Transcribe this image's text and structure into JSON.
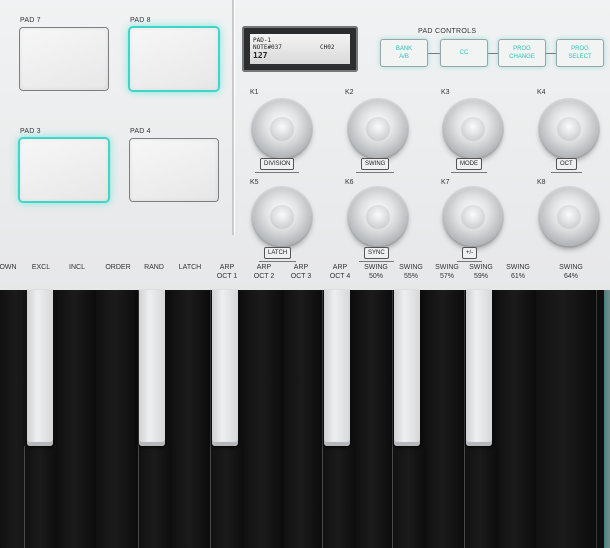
{
  "pads": [
    {
      "label": "PAD 7",
      "lit": false
    },
    {
      "label": "PAD 8",
      "lit": true
    },
    {
      "label": "PAD 3",
      "lit": true
    },
    {
      "label": "PAD 4",
      "lit": false
    }
  ],
  "display": {
    "line1": "PAD-1",
    "line2": "NOTE#037",
    "channel": "CH02",
    "value": "127"
  },
  "pad_controls": {
    "title": "PAD CONTROLS",
    "buttons": [
      {
        "line1": "BANK",
        "line2": "A/B"
      },
      {
        "line1": "CC",
        "line2": ""
      },
      {
        "line1": "PROG",
        "line2": "CHANGE"
      },
      {
        "line1": "PROG",
        "line2": "SELECT"
      }
    ]
  },
  "knobs": [
    {
      "id": "K1",
      "tag": "DIVISION"
    },
    {
      "id": "K2",
      "tag": "SWING"
    },
    {
      "id": "K3",
      "tag": "MODE"
    },
    {
      "id": "K4",
      "tag": "OCT"
    },
    {
      "id": "K5",
      "tag": "LATCH"
    },
    {
      "id": "K6",
      "tag": "SYNC"
    },
    {
      "id": "K7",
      "tag": "+/-"
    },
    {
      "id": "K8",
      "tag": ""
    }
  ],
  "key_labels": [
    {
      "line1": "",
      "line2": "OWN"
    },
    {
      "line1": "",
      "line2": "EXCL"
    },
    {
      "line1": "",
      "line2": "INCL"
    },
    {
      "line1": "",
      "line2": "ORDER"
    },
    {
      "line1": "",
      "line2": "RAND"
    },
    {
      "line1": "",
      "line2": "LATCH"
    },
    {
      "line1": "ARP",
      "line2": "OCT 1"
    },
    {
      "line1": "ARP",
      "line2": "OCT 2"
    },
    {
      "line1": "ARP",
      "line2": "OCT 3"
    },
    {
      "line1": "ARP",
      "line2": "OCT 4"
    },
    {
      "line1": "SWING",
      "line2": "50%"
    },
    {
      "line1": "SWING",
      "line2": "55%"
    },
    {
      "line1": "SWING",
      "line2": "57%"
    },
    {
      "line1": "SWING",
      "line2": "59%"
    },
    {
      "line1": "SWING",
      "line2": "61%"
    },
    {
      "line1": "SWING",
      "line2": "64%"
    }
  ],
  "colors": {
    "accent": "#3fd6c8",
    "panel": "#e8e9ea",
    "keys": "#0f0f10"
  }
}
